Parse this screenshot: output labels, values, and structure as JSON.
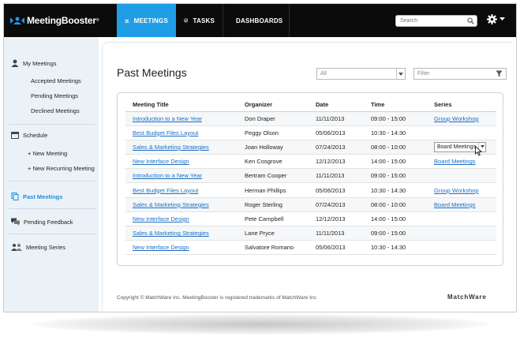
{
  "app": {
    "name": "MeetingBooster",
    "trademark": "®",
    "brand_color": "#1f9ee6",
    "link_color": "#1a6fc4"
  },
  "nav": {
    "tabs": [
      {
        "label": "MEETINGS",
        "icon": "people-icon",
        "active": true
      },
      {
        "label": "TASKS",
        "icon": "check-circle-icon",
        "active": false
      },
      {
        "label": "DASHBOARDS",
        "icon": "chart-icon",
        "active": false
      }
    ],
    "search_placeholder": "Search",
    "settings_icon": "gear-icon"
  },
  "sidebar": {
    "my_meetings": {
      "label": "My Meetings",
      "items": [
        "Accepted Meetings",
        "Pending Meetings",
        "Declined Meetings"
      ]
    },
    "schedule": {
      "label": "Schedule",
      "items": [
        "+ New Meeting",
        "+ New Recurring Meeting"
      ]
    },
    "past_meetings": {
      "label": "Past Meetings",
      "active": true
    },
    "pending_feedback": {
      "label": "Pending Feedback"
    },
    "meeting_series": {
      "label": "Meeting Series"
    }
  },
  "main": {
    "title": "Past Meetings",
    "filter_select": "All",
    "filter_input_placeholder": "Filter",
    "table": {
      "columns": [
        "Meeting Title",
        "Organizer",
        "Date",
        "Time",
        "Series"
      ],
      "rows": [
        {
          "title": "Introduction to a New Year",
          "organizer": "Don Draper",
          "date": "11/11/2013",
          "time": "09:00 - 15:00",
          "series": "Group Workshop",
          "series_type": "link"
        },
        {
          "title": "Best Budget Files Layout",
          "organizer": "Peggy Olson",
          "date": "05/06/2013",
          "time": "10:30 - 14:30",
          "series": "",
          "series_type": "none"
        },
        {
          "title": "Sales & Marketing Strategies",
          "organizer": "Joan Holloway",
          "date": "07/24/2013",
          "time": "08:00 - 10:00",
          "series": "Board Meetings",
          "series_type": "select"
        },
        {
          "title": "New Interface Design",
          "organizer": "Ken Cosgrove",
          "date": "12/12/2013",
          "time": "14:00 - 15:00",
          "series": "Board Meetings",
          "series_type": "link"
        },
        {
          "title": "Introduction to a New Year",
          "organizer": "Bertram Cooper",
          "date": "11/11/2013",
          "time": "09:00 - 15:00",
          "series": "",
          "series_type": "none"
        },
        {
          "title": "Best Budget Files Layout",
          "organizer": "Herman Phillips",
          "date": "05/06/2013",
          "time": "10:30 - 14:30",
          "series": "Group Workshop",
          "series_type": "link"
        },
        {
          "title": "Sales & Marketing Strategies",
          "organizer": "Roger Sterling",
          "date": "07/24/2013",
          "time": "08:00 - 10:00",
          "series": "Board Meetings",
          "series_type": "link"
        },
        {
          "title": "New Interface Design",
          "organizer": "Pete Campbell",
          "date": "12/12/2013",
          "time": "14:00 - 15:00",
          "series": "",
          "series_type": "none"
        },
        {
          "title": "Sales & Marketing Strategies",
          "organizer": "Lane Pryce",
          "date": "11/11/2013",
          "time": "09:00 - 15:00",
          "series": "",
          "series_type": "none"
        },
        {
          "title": "New Interface Design",
          "organizer": "Salvatore Romano",
          "date": "05/06/2013",
          "time": "10:30 - 14:30",
          "series": "",
          "series_type": "none"
        }
      ]
    }
  },
  "footer": {
    "copyright": "Copyright © MatchWare Inc.  MeetingBooster is registered trademarks of MatchWare Inc",
    "brand": "MatchWare"
  }
}
